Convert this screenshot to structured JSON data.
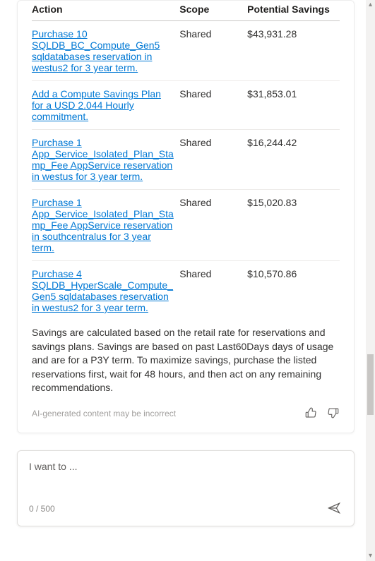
{
  "table": {
    "headers": [
      "Action",
      "Scope",
      "Potential Savings"
    ],
    "rows": [
      {
        "action": "Purchase 10 SQLDB_BC_Compute_Gen5 sqldatabases reservation in westus2 for 3 year term.",
        "scope": "Shared",
        "savings": "$43,931.28"
      },
      {
        "action": "Add a Compute Savings Plan for a USD 2.044 Hourly commitment.",
        "scope": "Shared",
        "savings": "$31,853.01"
      },
      {
        "action": "Purchase 1 App_Service_Isolated_Plan_Stamp_Fee AppService reservation in westus for 3 year term.",
        "scope": "Shared",
        "savings": "$16,244.42"
      },
      {
        "action": "Purchase 1 App_Service_Isolated_Plan_Stamp_Fee AppService reservation in southcentralus for 3 year term.",
        "scope": "Shared",
        "savings": "$15,020.83"
      },
      {
        "action": "Purchase 4 SQLDB_HyperScale_Compute_Gen5 sqldatabases reservation in westus2 for 3 year term.",
        "scope": "Shared",
        "savings": "$10,570.86"
      }
    ]
  },
  "footnote": "Savings are calculated based on the retail rate for reservations and savings plans. Savings are based on past Last60Days days of usage and are for a P3Y term. To maximize savings, purchase the listed reservations first, wait for 48 hours, and then act on any remaining recommendations.",
  "ai_disclaimer": "AI-generated content may be incorrect",
  "composer": {
    "placeholder": "I want to ...",
    "char_count": "0 / 500"
  }
}
